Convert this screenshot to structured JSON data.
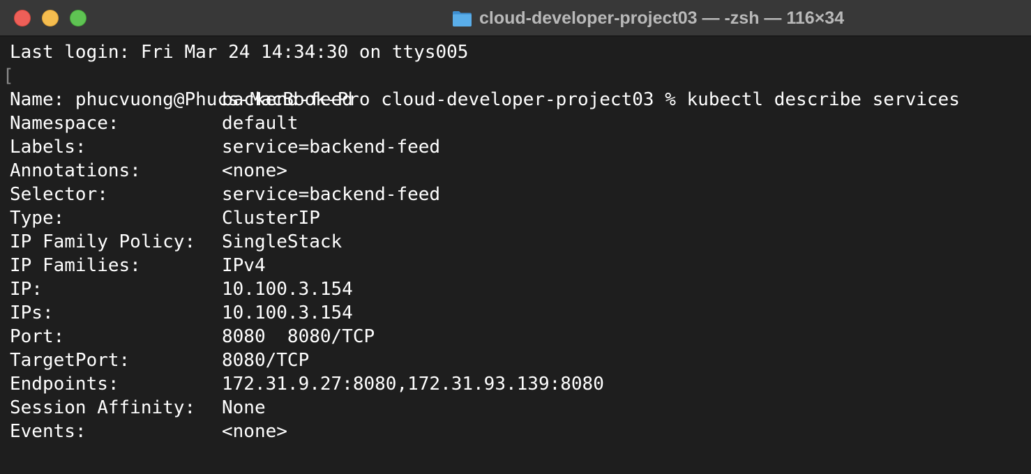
{
  "window": {
    "title": "cloud-developer-project03 — -zsh — 116×34",
    "icons": {
      "close": "close-button",
      "minimize": "minimize-button",
      "zoom": "zoom-button",
      "folder": "folder-icon"
    },
    "colors": {
      "background": "#1e1e1e",
      "titlebar": "#383838",
      "text": "#ffffff",
      "close": "#ee5f58",
      "minimize": "#f5bd4f",
      "zoom": "#5fc353",
      "folder": "#5aaeea"
    }
  },
  "terminal": {
    "last_login": "Last login: Fri Mar 24 14:34:30 on ttys005",
    "cursor_marker": "[",
    "prompt": "phucvuong@Phucs-MacBook-Pro cloud-developer-project03 % kubectl describe services",
    "fields": [
      {
        "label": "Name:",
        "value": "backend-feed"
      },
      {
        "label": "Namespace:",
        "value": "default"
      },
      {
        "label": "Labels:",
        "value": "service=backend-feed"
      },
      {
        "label": "Annotations:",
        "value": "<none>"
      },
      {
        "label": "Selector:",
        "value": "service=backend-feed"
      },
      {
        "label": "Type:",
        "value": "ClusterIP"
      },
      {
        "label": "IP Family Policy:",
        "value": "SingleStack"
      },
      {
        "label": "IP Families:",
        "value": "IPv4"
      },
      {
        "label": "IP:",
        "value": "10.100.3.154"
      },
      {
        "label": "IPs:",
        "value": "10.100.3.154"
      },
      {
        "label": "Port:",
        "value": "8080  8080/TCP"
      },
      {
        "label": "TargetPort:",
        "value": "8080/TCP"
      },
      {
        "label": "Endpoints:",
        "value": "172.31.9.27:8080,172.31.93.139:8080"
      },
      {
        "label": "Session Affinity:",
        "value": "None"
      },
      {
        "label": "Events:",
        "value": "<none>"
      }
    ]
  }
}
